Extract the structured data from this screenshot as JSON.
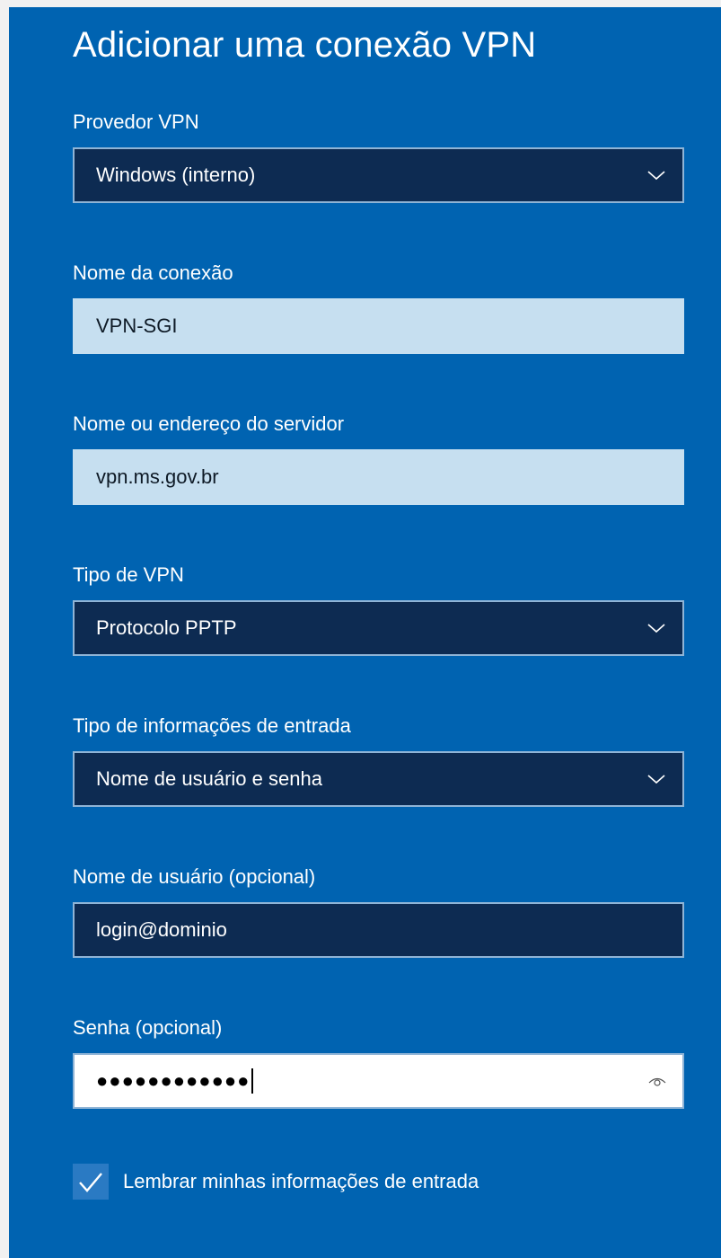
{
  "dialog": {
    "title": "Adicionar uma conexão VPN"
  },
  "form": {
    "vpn_provider": {
      "label": "Provedor VPN",
      "value": "Windows (interno)"
    },
    "connection_name": {
      "label": "Nome da conexão",
      "value": "VPN-SGI"
    },
    "server": {
      "label": "Nome ou endereço do servidor",
      "value": "vpn.ms.gov.br"
    },
    "vpn_type": {
      "label": "Tipo de VPN",
      "value": "Protocolo PPTP"
    },
    "signin_type": {
      "label": "Tipo de informações de entrada",
      "value": "Nome de usuário e senha"
    },
    "username": {
      "label": "Nome de usuário (opcional)",
      "value": "login@dominio"
    },
    "password": {
      "label": "Senha (opcional)",
      "masked_value": "●●●●●●●●●●●●"
    },
    "remember": {
      "label": "Lembrar minhas informações de entrada",
      "checked": true
    }
  },
  "icons": {
    "dropdown": "chevron-down-icon",
    "reveal_password": "eye-icon",
    "checkmark": "checkmark-icon"
  },
  "colors": {
    "panel_background": "#0063b1",
    "dark_field": "#0d2b52",
    "light_field": "#c6dff0",
    "active_field": "#ffffff",
    "field_border": "#8fb4d6"
  }
}
